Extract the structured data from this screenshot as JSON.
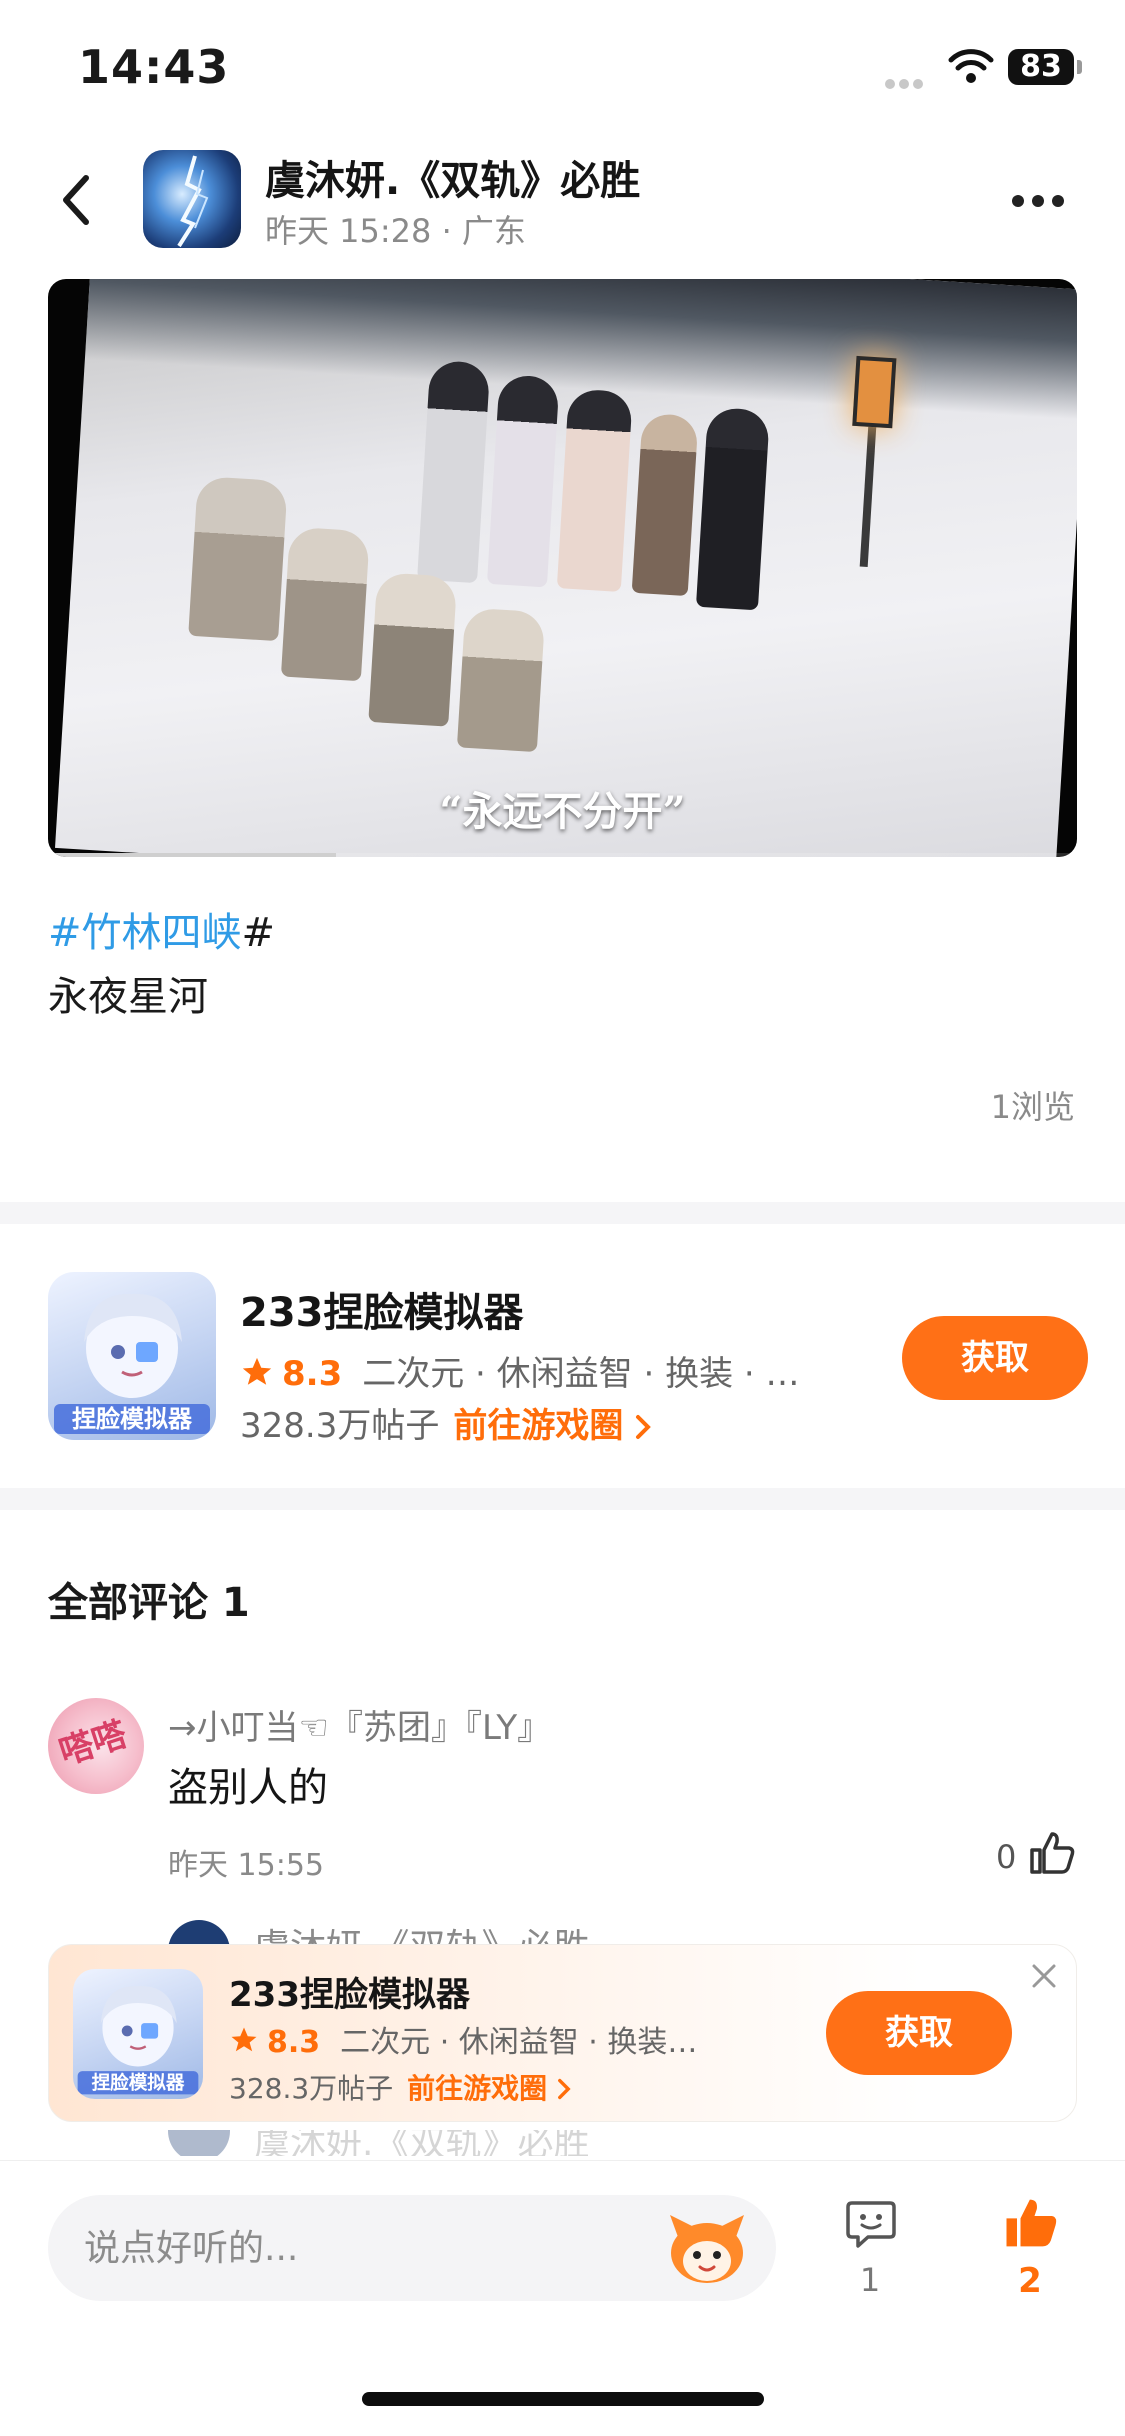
{
  "status_bar": {
    "time": "14:43",
    "battery": "83"
  },
  "header": {
    "author_name": "虞沐妍.《双轨》必胜",
    "post_time": "昨天 15:28",
    "location": "广东",
    "meta_separator": "·"
  },
  "video": {
    "caption": "“永远不分开”",
    "progress": 0.28
  },
  "post": {
    "topic": "#竹林四峡",
    "topic_close": "#",
    "body": "永夜星河",
    "views": "1浏览"
  },
  "game_card": {
    "name": "233捏脸模拟器",
    "rating": "8.3",
    "tags": "二次元 · 休闲益智 · 换装 · …",
    "posts": "328.3万帖子",
    "circle_link": "前往游戏圈",
    "get_label": "获取"
  },
  "comments": {
    "title": "全部评论 1",
    "items": [
      {
        "user": "→小叮当☜『苏团』『LY』",
        "text": "盗别人的",
        "time": "昨天 15:55",
        "likes": "0",
        "avatar_text": "嗒嗒"
      }
    ],
    "reply_preview": "虞沐妍.《双轨》必胜"
  },
  "promo": {
    "name": "233捏脸模拟器",
    "rating": "8.3",
    "tags": "二次元 · 休闲益智 · 换装…",
    "posts": "328.3万帖子",
    "circle_link": "前往游戏圈",
    "get_label": "获取"
  },
  "bottom_bar": {
    "input_placeholder": "说点好听的...",
    "comment_count": "1",
    "like_count": "2"
  },
  "colors": {
    "accent": "#ff7016",
    "topic": "#2f9be6",
    "rating": "#ff6d0a"
  }
}
